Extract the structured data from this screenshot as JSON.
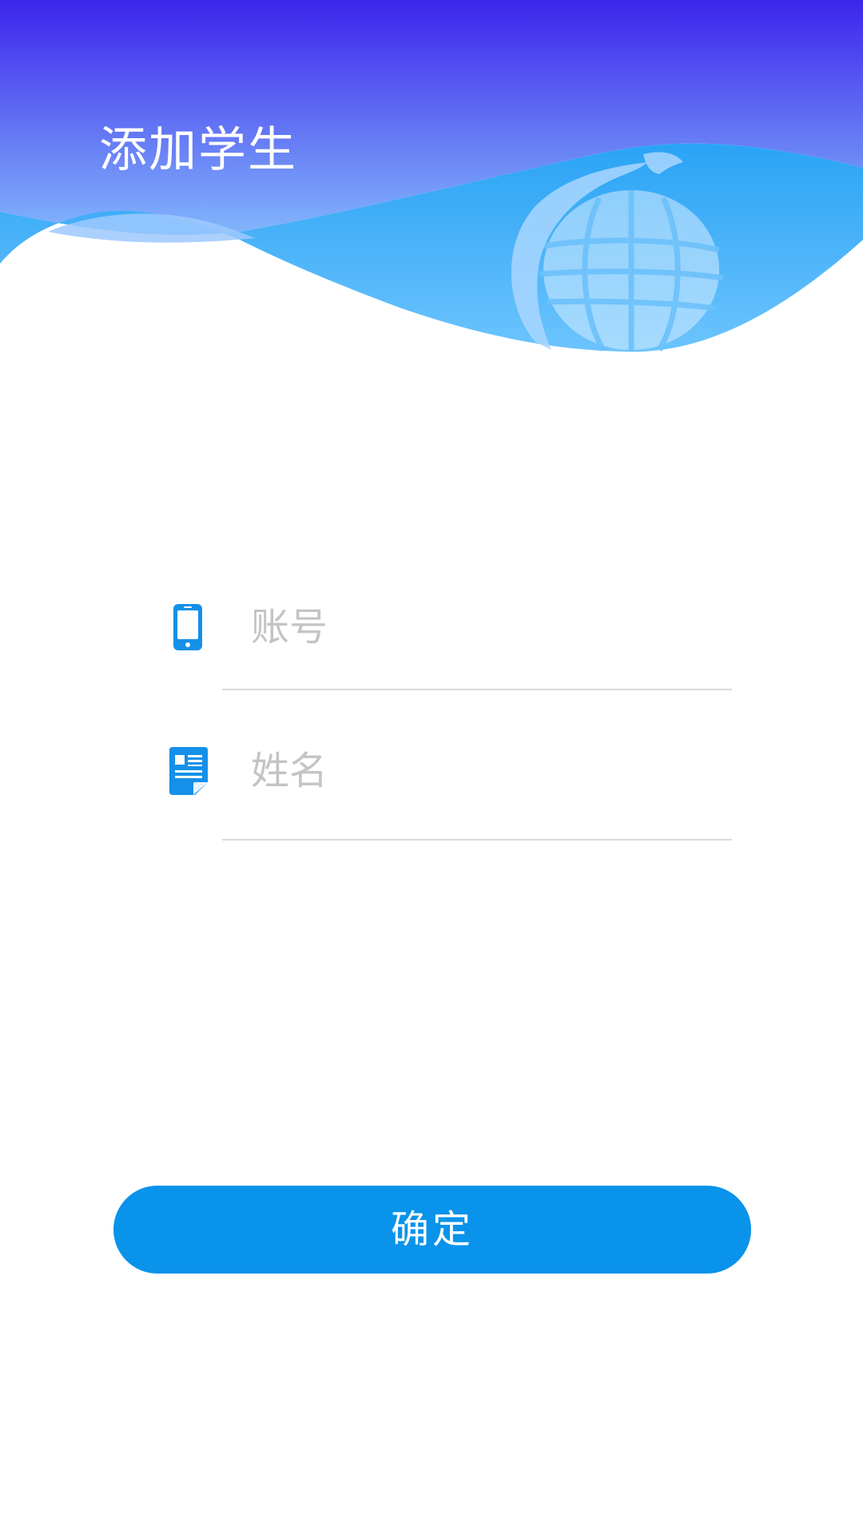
{
  "header": {
    "title": "添加学生",
    "logo": "dragon-globe-icon"
  },
  "form": {
    "account": {
      "icon": "phone-icon",
      "placeholder": "账号",
      "value": ""
    },
    "name": {
      "icon": "document-icon",
      "placeholder": "姓名",
      "value": ""
    }
  },
  "actions": {
    "confirm_label": "确定"
  },
  "colors": {
    "header_gradient_top": "#3d25ec",
    "header_gradient_bottom": "#54b9fb",
    "accent": "#0993ea",
    "placeholder": "#c4c4c4",
    "divider": "#dadada"
  }
}
